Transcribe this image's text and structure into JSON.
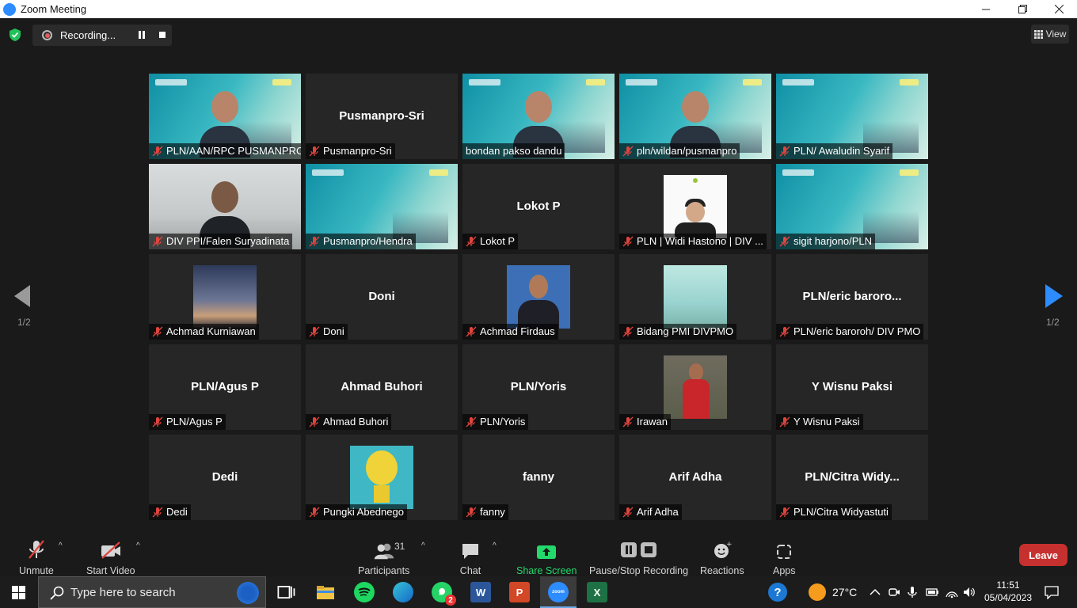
{
  "window": {
    "title": "Zoom Meeting",
    "logo_text": "zoom"
  },
  "recording": {
    "status": "Recording..."
  },
  "view": {
    "label": "View"
  },
  "pagination": {
    "left": "1/2",
    "right": "1/2"
  },
  "participants": [
    {
      "name": "PLN/AAN/RPC PUSMANPRO",
      "display": "",
      "video": "banner-person",
      "muted": true
    },
    {
      "name": "Pusmanpro-Sri",
      "display": "Pusmanpro-Sri",
      "video": "none",
      "muted": true
    },
    {
      "name": "bondan pakso dandu",
      "display": "",
      "video": "banner-person",
      "muted": false,
      "active": true
    },
    {
      "name": "pln/wildan/pusmanpro",
      "display": "",
      "video": "banner-person",
      "muted": true
    },
    {
      "name": "PLN/ Awaludin Syarif",
      "display": "",
      "video": "banner",
      "muted": true
    },
    {
      "name": "DIV PPI/Falen Suryadinata",
      "display": "",
      "video": "office-person",
      "muted": true
    },
    {
      "name": "Pusmanpro/Hendra",
      "display": "",
      "video": "banner",
      "muted": true
    },
    {
      "name": "Lokot P",
      "display": "Lokot P",
      "video": "none",
      "muted": true
    },
    {
      "name": "PLN | Widi Hastono | DIV ...",
      "display": "",
      "video": "pic-mask",
      "muted": true
    },
    {
      "name": "sigit harjono/PLN",
      "display": "",
      "video": "banner",
      "muted": true
    },
    {
      "name": "Achmad Kurniawan",
      "display": "",
      "video": "pic-sky",
      "muted": true
    },
    {
      "name": "Doni",
      "display": "Doni",
      "video": "none",
      "muted": true
    },
    {
      "name": "Achmad Firdaus",
      "display": "",
      "video": "pic-formal",
      "muted": true
    },
    {
      "name": "Bidang PMI DIVPMO",
      "display": "",
      "video": "pic-city",
      "muted": true
    },
    {
      "name": "PLN/eric baroroh/ DIV PMO",
      "display": "PLN/eric  baroro...",
      "video": "none",
      "muted": true
    },
    {
      "name": "PLN/Agus P",
      "display": "PLN/Agus P",
      "video": "none",
      "muted": true
    },
    {
      "name": "Ahmad Buhori",
      "display": "Ahmad Buhori",
      "video": "none",
      "muted": true
    },
    {
      "name": "PLN/Yoris",
      "display": "PLN/Yoris",
      "video": "none",
      "muted": true
    },
    {
      "name": "Irawan",
      "display": "",
      "video": "pic-red",
      "muted": true
    },
    {
      "name": "Y Wisnu Paksi",
      "display": "Y Wisnu Paksi",
      "video": "none",
      "muted": true
    },
    {
      "name": "Dedi",
      "display": "Dedi",
      "video": "none",
      "muted": true
    },
    {
      "name": "Pungki Abednego",
      "display": "",
      "video": "pic-bulb",
      "muted": true
    },
    {
      "name": "fanny",
      "display": "fanny",
      "video": "none",
      "muted": true
    },
    {
      "name": "Arif Adha",
      "display": "Arif Adha",
      "video": "none",
      "muted": true
    },
    {
      "name": "PLN/Citra Widyastuti",
      "display": "PLN/Citra  Widy...",
      "video": "none",
      "muted": true
    }
  ],
  "toolbar": {
    "unmute": "Unmute",
    "start_video": "Start Video",
    "participants": "Participants",
    "participants_count": "31",
    "chat": "Chat",
    "share_screen": "Share Screen",
    "recording": "Pause/Stop Recording",
    "reactions": "Reactions",
    "apps": "Apps",
    "leave": "Leave"
  },
  "taskbar": {
    "search_placeholder": "Type here to search",
    "temperature": "27°C",
    "time": "11:51",
    "date": "05/04/2023",
    "whatsapp_badge": "2"
  },
  "colors": {
    "active_speaker": "#b5d335",
    "leave": "#c6302e",
    "share": "#23d96b",
    "nav_arrow": "#2d8cff"
  }
}
